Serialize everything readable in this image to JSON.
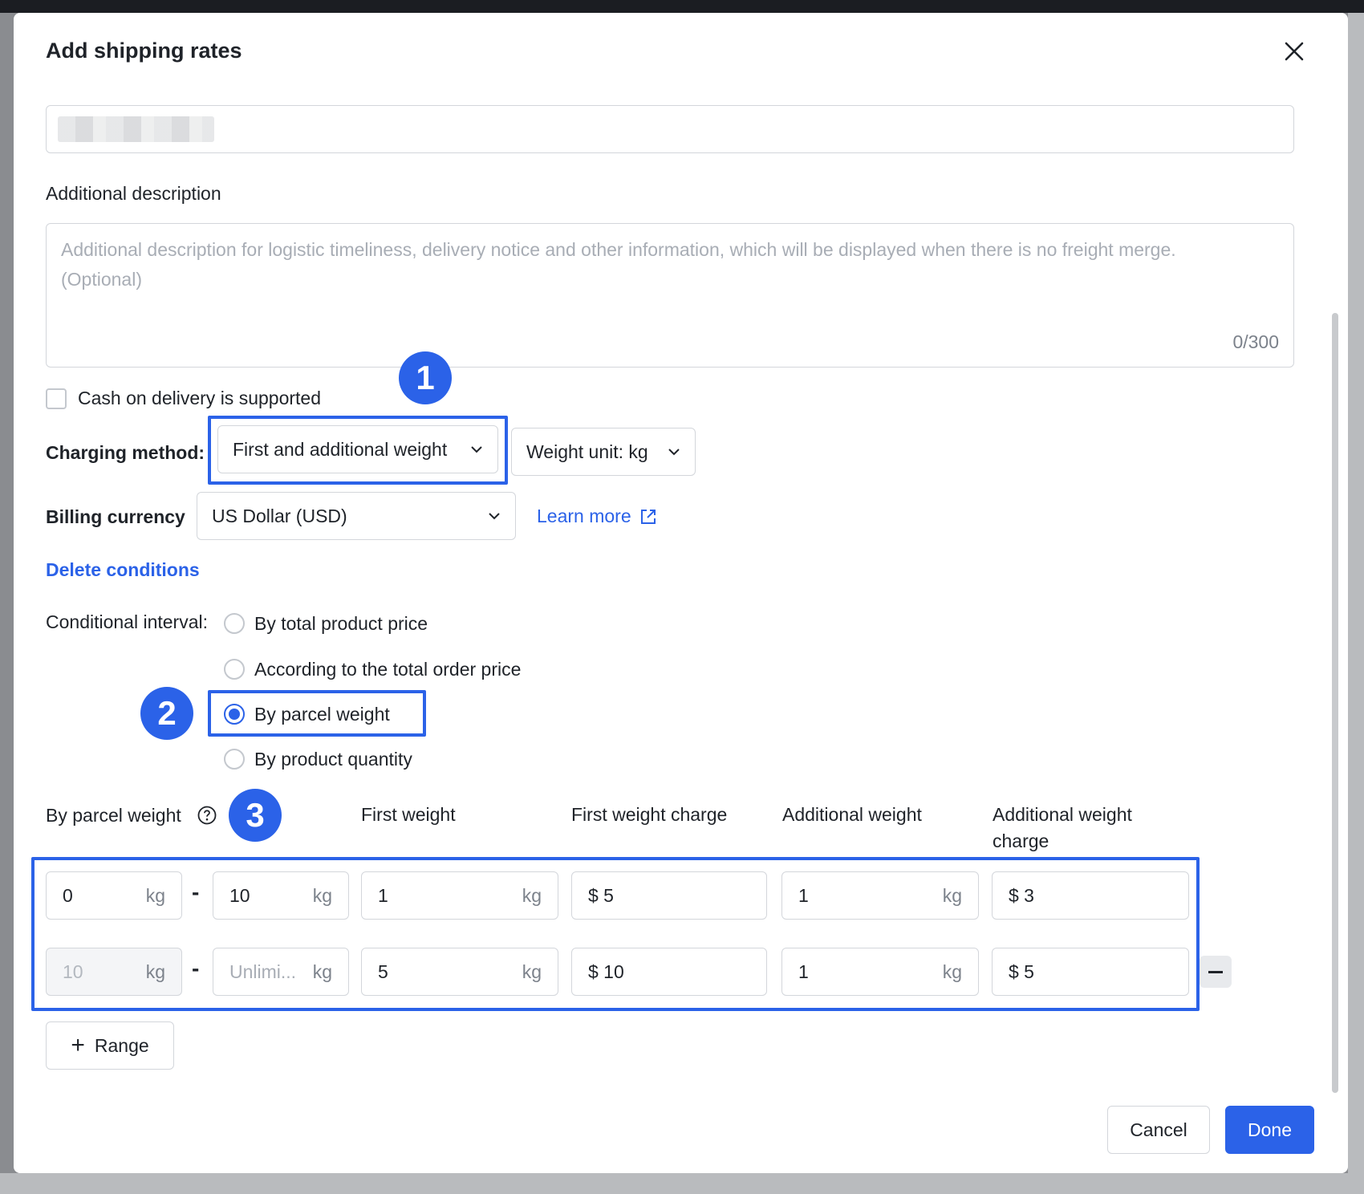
{
  "dialog": {
    "title": "Add shipping rates"
  },
  "description": {
    "label": "Additional description",
    "placeholder": "Additional description for logistic timeliness, delivery notice and other information, which will be displayed when there is no freight merge.",
    "placeholder_line2": "(Optional)",
    "counter": "0/300"
  },
  "cod": {
    "label": "Cash on delivery is supported",
    "checked": false
  },
  "charging": {
    "label": "Charging method:",
    "method": "First and additional weight",
    "weight_unit": "Weight unit: kg"
  },
  "billing": {
    "label": "Billing currency",
    "currency": "US Dollar (USD)",
    "learn_more": "Learn more"
  },
  "conditions": {
    "delete_label": "Delete conditions",
    "interval_label": "Conditional interval:",
    "options": [
      {
        "label": "By total product price",
        "selected": false
      },
      {
        "label": "According to the total order price",
        "selected": false
      },
      {
        "label": "By parcel weight",
        "selected": true
      },
      {
        "label": "By product quantity",
        "selected": false
      }
    ]
  },
  "table": {
    "headers": {
      "range": "By parcel weight",
      "first_weight": "First weight",
      "first_charge": "First weight charge",
      "add_weight": "Additional weight",
      "add_charge_1": "Additional weight",
      "add_charge_2": "charge"
    },
    "rows": [
      {
        "from": "0",
        "to": "10",
        "first_weight": "1",
        "first_charge": "$ 5",
        "add_weight": "1",
        "add_charge": "$ 3"
      },
      {
        "from": "10",
        "to": "Unlimi...",
        "first_weight": "5",
        "first_charge": "$ 10",
        "add_weight": "1",
        "add_charge": "$ 5"
      }
    ],
    "unit": "kg",
    "dash": "-",
    "add_range": "Range"
  },
  "annotations": {
    "badge_1": "1",
    "badge_2": "2",
    "badge_3": "3",
    "color": "#2b62e8"
  },
  "footer": {
    "cancel": "Cancel",
    "done": "Done"
  }
}
